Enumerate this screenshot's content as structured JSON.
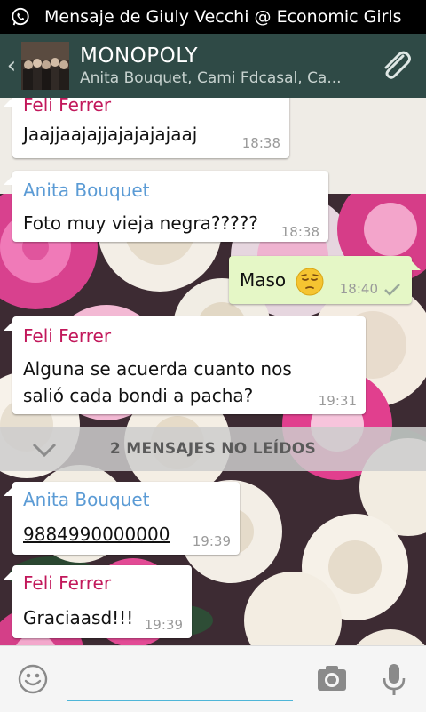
{
  "statusbar": {
    "notification_text": "Mensaje de Giuly Vecchi @ Economic Girls"
  },
  "header": {
    "title": "MONOPOLY",
    "subtitle": "Anita Bouquet, Cami Fdcasal, Ca..."
  },
  "messages": [
    {
      "sender": "Feli Ferrer",
      "text": "Jaajjaajajjajajajajaaj",
      "time": "18:38"
    },
    {
      "sender": "Anita Bouquet",
      "text": "Foto muy vieja negra?????",
      "time": "18:38"
    },
    {
      "text": "Maso",
      "time": "18:40",
      "outgoing": true
    },
    {
      "sender": "Feli Ferrer",
      "line1": "Alguna se acuerda cuanto nos",
      "line2": "salió cada bondi a pacha?",
      "time": "19:31"
    },
    {
      "sender": "Anita Bouquet",
      "text": "9884990000000",
      "time": "19:39"
    },
    {
      "sender": "Feli Ferrer",
      "text": "Graciaasd!!!",
      "time": "19:39"
    }
  ],
  "unread_divider": "2 MENSAJES NO LEÍDOS",
  "input": {
    "placeholder": ""
  },
  "colors": {
    "actionbar": "#2f4a46",
    "sender_pink": "#c2185b",
    "sender_blue": "#5b9bd5",
    "link": "#3aa7d6",
    "outgoing_bubble": "#e5f7c6"
  },
  "icons": [
    "whatsapp-icon",
    "back-chevron-icon",
    "attach-paperclip-icon",
    "emoji-icon",
    "camera-icon",
    "microphone-icon",
    "chevron-down-icon",
    "pensive-face-emoji",
    "delivered-check-icon"
  ]
}
